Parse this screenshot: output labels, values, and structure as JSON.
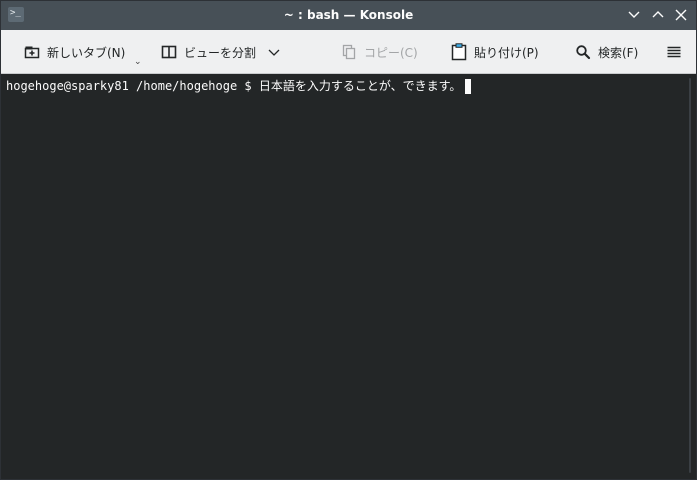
{
  "window": {
    "title": "~ : bash — Konsole",
    "app_icon_glyph": ">_"
  },
  "titlebar_buttons": [
    {
      "name": "minimize-icon"
    },
    {
      "name": "maximize-icon"
    },
    {
      "name": "close-icon"
    }
  ],
  "toolbar": {
    "new_tab_label": "新しいタブ(N)",
    "split_view_label": "ビューを分割",
    "copy_label": "コピー(C)",
    "paste_label": "貼り付け(P)",
    "find_label": "検索(F)"
  },
  "terminal": {
    "prompt": "hogehoge@sparky81 /home/hogehoge $ ",
    "input": "日本語を入力することが、できます。"
  },
  "colors": {
    "titlebar_bg": "#475057",
    "toolbar_bg": "#eff0f1",
    "terminal_bg": "#232627",
    "terminal_fg": "#fcfcfc"
  }
}
